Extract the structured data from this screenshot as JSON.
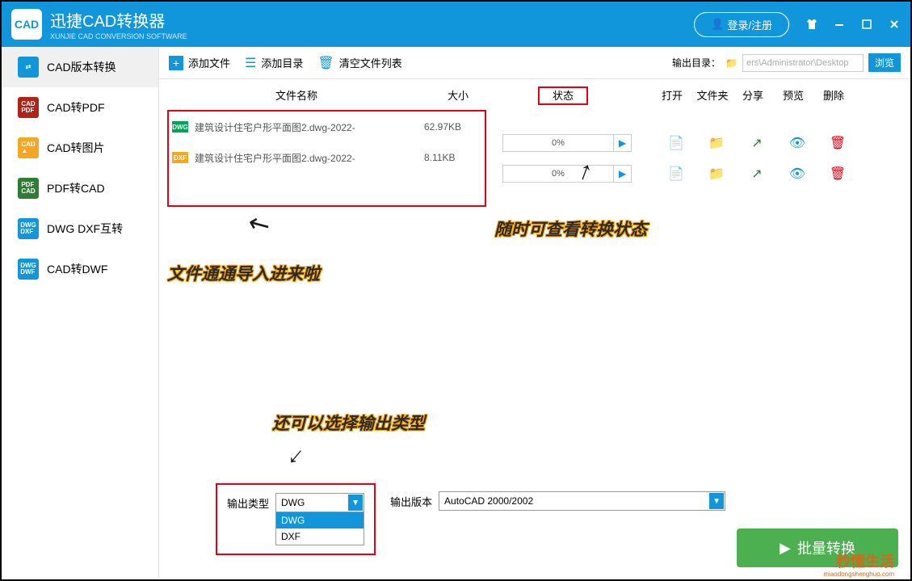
{
  "header": {
    "logo_text": "CAD",
    "title": "迅捷CAD转换器",
    "subtitle": "XUNJIE CAD CONVERSION SOFTWARE",
    "login": "登录/注册"
  },
  "sidebar": {
    "items": [
      {
        "label": "CAD版本转换",
        "icon_bg": "#1296db"
      },
      {
        "label": "CAD转PDF",
        "icon_bg": "#b02418"
      },
      {
        "label": "CAD转图片",
        "icon_bg": "#f5a623"
      },
      {
        "label": "PDF转CAD",
        "icon_bg": "#2e7d32"
      },
      {
        "label": "DWG DXF互转",
        "icon_bg": "#1296db"
      },
      {
        "label": "CAD转DWF",
        "icon_bg": "#1296db"
      }
    ]
  },
  "toolbar": {
    "add_file": "添加文件",
    "add_folder": "添加目录",
    "clear_list": "清空文件列表",
    "output_dir_label": "输出目录：",
    "output_dir_value": "ers\\Administrator\\Desktop",
    "browse": "浏览"
  },
  "table": {
    "headers": {
      "name": "文件名称",
      "size": "大小",
      "status": "状态",
      "open": "打开",
      "folder": "文件夹",
      "share": "分享",
      "preview": "预览",
      "delete": "删除"
    }
  },
  "files": [
    {
      "icon": "DWG",
      "icon_bg": "#00a651",
      "name": "建筑设计住宅户形平面图2.dwg-2022-",
      "size": "62.97KB",
      "progress": "0%"
    },
    {
      "icon": "DXF",
      "icon_bg": "#f5a623",
      "name": "建筑设计住宅户形平面图2.dwg-2022-",
      "size": "8.11KB",
      "progress": "0%"
    }
  ],
  "annotations": {
    "files_imported": "文件通通导入进来啦",
    "check_status": "随时可查看转换状态",
    "select_output": "还可以选择输出类型"
  },
  "output": {
    "type_label": "输出类型",
    "type_selected": "DWG",
    "type_options": [
      "DWG",
      "DXF"
    ],
    "version_label": "输出版本",
    "version_selected": "AutoCAD 2000/2002"
  },
  "batch_button": "批量转换",
  "watermark": "秒懂生活",
  "watermark_sub": "miaodongshenghuo.com"
}
